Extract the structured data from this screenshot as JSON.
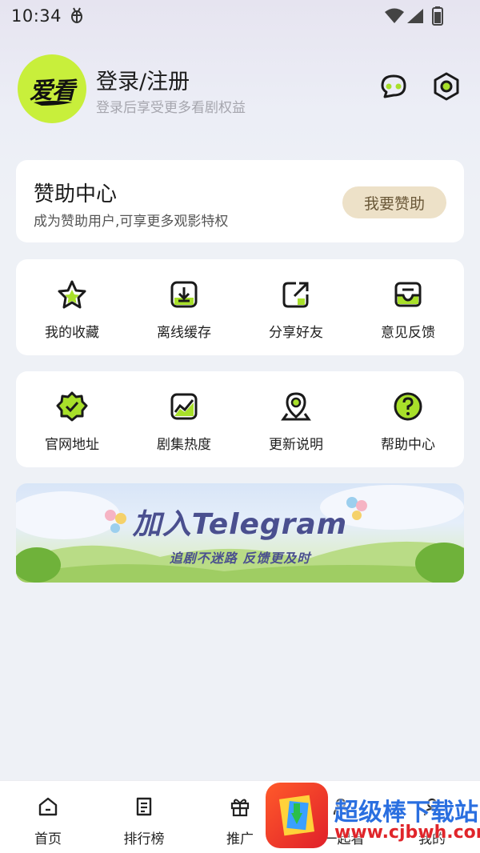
{
  "status_bar": {
    "time": "10:34",
    "icons": [
      "bug-icon",
      "wifi-icon",
      "signal-icon",
      "battery-icon"
    ]
  },
  "header": {
    "logo_text": "爱看",
    "login_title": "登录/注册",
    "login_subtitle": "登录后享受更多看剧权益",
    "icons": [
      "message-icon",
      "settings-icon"
    ],
    "logo_color": "#c8ef3b"
  },
  "sponsor": {
    "title": "赞助中心",
    "subtitle": "成为赞助用户,可享更多观影特权",
    "button": "我要赞助"
  },
  "grid1": [
    {
      "label": "我的收藏",
      "icon": "star-icon"
    },
    {
      "label": "离线缓存",
      "icon": "download-icon"
    },
    {
      "label": "分享好友",
      "icon": "share-icon"
    },
    {
      "label": "意见反馈",
      "icon": "inbox-icon"
    }
  ],
  "grid2": [
    {
      "label": "官网地址",
      "icon": "badge-check-icon"
    },
    {
      "label": "剧集热度",
      "icon": "trend-icon"
    },
    {
      "label": "更新说明",
      "icon": "location-icon"
    },
    {
      "label": "帮助中心",
      "icon": "help-icon"
    }
  ],
  "banner": {
    "title": "加入Telegram",
    "subtitle": "追剧不迷路 反馈更及时"
  },
  "bottom_nav": [
    {
      "label": "首页",
      "icon": "home-icon"
    },
    {
      "label": "排行榜",
      "icon": "ranking-icon"
    },
    {
      "label": "推广",
      "icon": "gift-icon"
    },
    {
      "label": "一起看",
      "icon": "watch-together-icon"
    },
    {
      "label": "我的",
      "icon": "profile-icon"
    }
  ],
  "watermark": {
    "text": "超级棒下载站",
    "url": "www.cjbwh.com"
  },
  "colors": {
    "accent": "#c8ef3b",
    "accent_icon": "#a8e02a",
    "sponsor_button_bg": "#ede1c8",
    "banner_text": "#4a4f8f"
  }
}
